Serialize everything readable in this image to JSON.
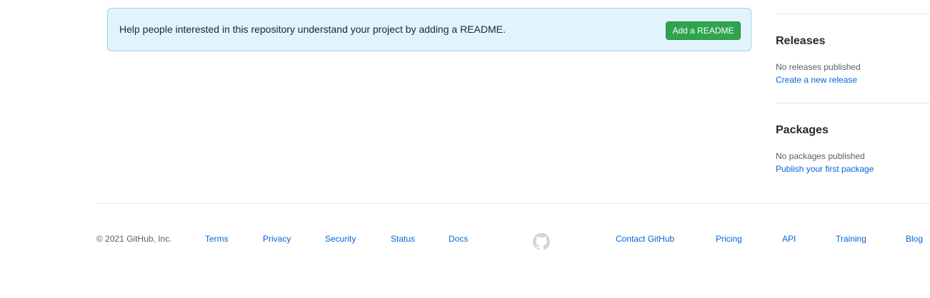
{
  "readme_banner": {
    "message": "Help people interested in this repository understand your project by adding a README.",
    "button_label": "Add a README"
  },
  "sidebar": {
    "releases": {
      "heading": "Releases",
      "empty_text": "No releases published",
      "link": "Create a new release"
    },
    "packages": {
      "heading": "Packages",
      "empty_text": "No packages published",
      "link": "Publish your first package"
    }
  },
  "footer": {
    "copyright": "© 2021 GitHub, Inc.",
    "left_links": [
      "Terms",
      "Privacy",
      "Security",
      "Status",
      "Docs"
    ],
    "logo_icon": "github-mark-icon",
    "right_links": [
      "Contact GitHub",
      "Pricing",
      "API",
      "Training",
      "Blog"
    ]
  },
  "colors": {
    "banner_background": "#e1f3fb",
    "button_green": "#2ea44f",
    "link_blue": "#0366d6"
  }
}
